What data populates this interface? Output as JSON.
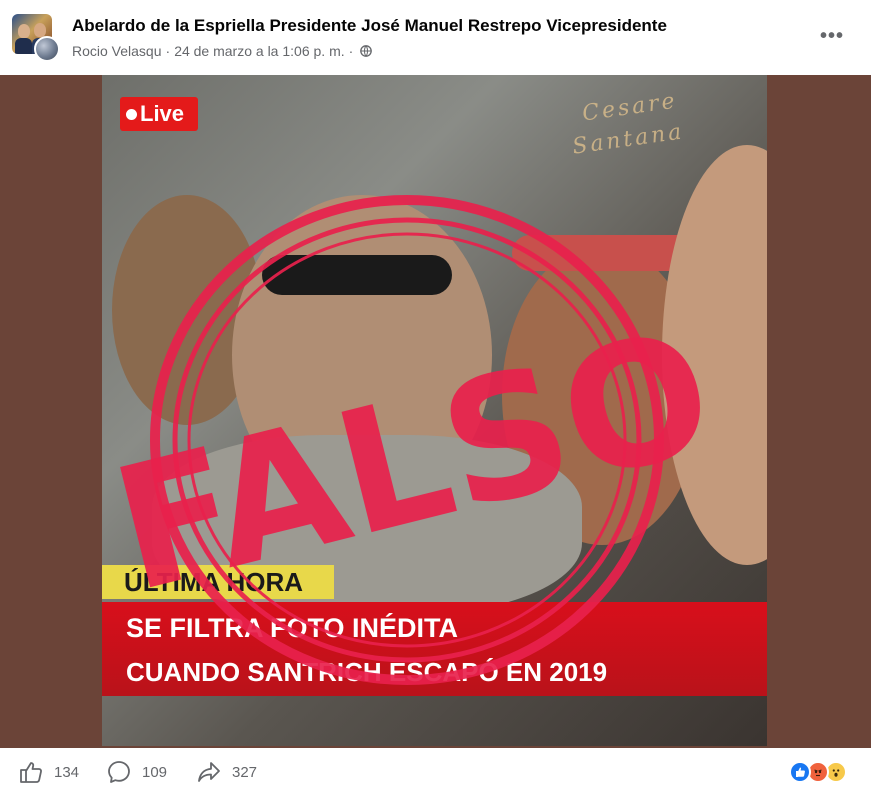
{
  "post": {
    "page_name": "Abelardo de la Espriella Presidente José Manuel Restrepo Vicepresidente",
    "author": "Rocio Velasqu",
    "separator": "·",
    "timestamp": "24 de marzo a la 1:06 p. m.",
    "separator2": "·",
    "more_label": "•••"
  },
  "image": {
    "live_label": "Live",
    "watermark_line1": "Cesare",
    "watermark_line2": "Santana",
    "stamp_text": "FALSO",
    "news_label": "ÚLTIMA HORA",
    "headline_line1": "SE FILTRA FOTO INÉDITA",
    "headline_line2": "CUANDO SANTRICH ESCAPÓ EN 2019",
    "colors": {
      "stamp": "#e8214c",
      "news_bar": "#d80f1b",
      "news_label_bg": "#e8d84a",
      "background": "#6b4438"
    }
  },
  "footer": {
    "likes": "134",
    "comments": "109",
    "shares": "327",
    "reactions": [
      "like-icon",
      "angry-icon",
      "wow-icon"
    ]
  }
}
